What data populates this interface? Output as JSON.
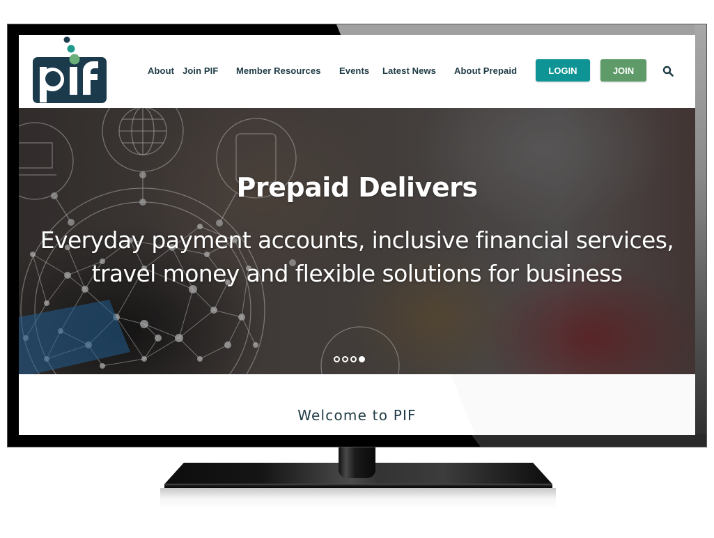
{
  "site": {
    "logo_text": "pif",
    "logo_colors": {
      "dark": "#1b3a4b",
      "teal": "#1f9b8c",
      "green": "#6bb07a"
    }
  },
  "nav": {
    "items": [
      {
        "label": "About"
      },
      {
        "label": "Join PIF"
      },
      {
        "label": "Member Resources"
      },
      {
        "label": "Events"
      },
      {
        "label": "Latest News"
      },
      {
        "label": "About Prepaid"
      }
    ],
    "login_label": "LOGIN",
    "join_label": "JOIN",
    "search_icon": "search-icon"
  },
  "colors": {
    "login_bg": "#0e9494",
    "join_bg": "#5f9b69",
    "nav_text": "#1d3a44"
  },
  "hero": {
    "title": "Prepaid Delivers",
    "subtitle_line1": "Everyday payment accounts, inclusive financial services,",
    "subtitle_line2": "travel money and flexible solutions for business",
    "carousel": {
      "total_slides": 4,
      "active_slide": 4
    }
  },
  "welcome": {
    "title": "Welcome to PIF"
  }
}
